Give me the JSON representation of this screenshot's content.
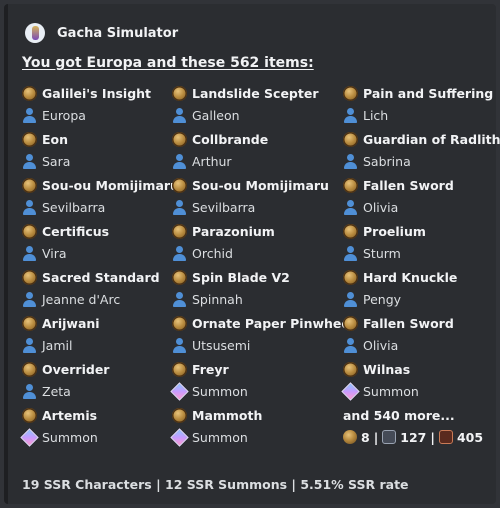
{
  "header": {
    "app_name": "Gacha Simulator"
  },
  "title": "You got Europa and these 562 items:",
  "columns": [
    [
      {
        "weapon": "Galilei's Insight",
        "sub": "Europa",
        "sub_type": "character"
      },
      {
        "weapon": "Eon",
        "sub": "Sara",
        "sub_type": "character"
      },
      {
        "weapon": "Sou-ou Momijimaru",
        "sub": "Sevilbarra",
        "sub_type": "character"
      },
      {
        "weapon": "Certificus",
        "sub": "Vira",
        "sub_type": "character"
      },
      {
        "weapon": "Sacred Standard",
        "sub": "Jeanne d'Arc",
        "sub_type": "character"
      },
      {
        "weapon": "Arijwani",
        "sub": "Jamil",
        "sub_type": "character"
      },
      {
        "weapon": "Overrider",
        "sub": "Zeta",
        "sub_type": "character"
      },
      {
        "weapon": "Artemis",
        "sub": "Summon",
        "sub_type": "summon"
      }
    ],
    [
      {
        "weapon": "Landslide Scepter",
        "sub": "Galleon",
        "sub_type": "character"
      },
      {
        "weapon": "Collbrande",
        "sub": "Arthur",
        "sub_type": "character"
      },
      {
        "weapon": "Sou-ou Momijimaru",
        "sub": "Sevilbarra",
        "sub_type": "character"
      },
      {
        "weapon": "Parazonium",
        "sub": "Orchid",
        "sub_type": "character"
      },
      {
        "weapon": "Spin Blade V2",
        "sub": "Spinnah",
        "sub_type": "character"
      },
      {
        "weapon": "Ornate Paper Pinwheel",
        "sub": "Utsusemi",
        "sub_type": "character"
      },
      {
        "weapon": "Freyr",
        "sub": "Summon",
        "sub_type": "summon"
      },
      {
        "weapon": "Mammoth",
        "sub": "Summon",
        "sub_type": "summon"
      }
    ],
    [
      {
        "weapon": "Pain and Suffering",
        "sub": "Lich",
        "sub_type": "character"
      },
      {
        "weapon": "Guardian of Radlith",
        "sub": "Sabrina",
        "sub_type": "character"
      },
      {
        "weapon": "Fallen Sword",
        "sub": "Olivia",
        "sub_type": "character"
      },
      {
        "weapon": "Proelium",
        "sub": "Sturm",
        "sub_type": "character"
      },
      {
        "weapon": "Hard Knuckle",
        "sub": "Pengy",
        "sub_type": "character"
      },
      {
        "weapon": "Fallen Sword",
        "sub": "Olivia",
        "sub_type": "character"
      },
      {
        "weapon": "Wilnas",
        "sub": "Summon",
        "sub_type": "summon"
      }
    ]
  ],
  "more": {
    "label": "and 540 more...",
    "stats": [
      {
        "icon": "gold-weapon-icon",
        "value": "8"
      },
      {
        "icon": "ssr-icon",
        "value": "127"
      },
      {
        "icon": "sr-icon",
        "value": "405"
      }
    ]
  },
  "footer": "19 SSR Characters | 12 SSR Summons | 5.51% SSR rate"
}
